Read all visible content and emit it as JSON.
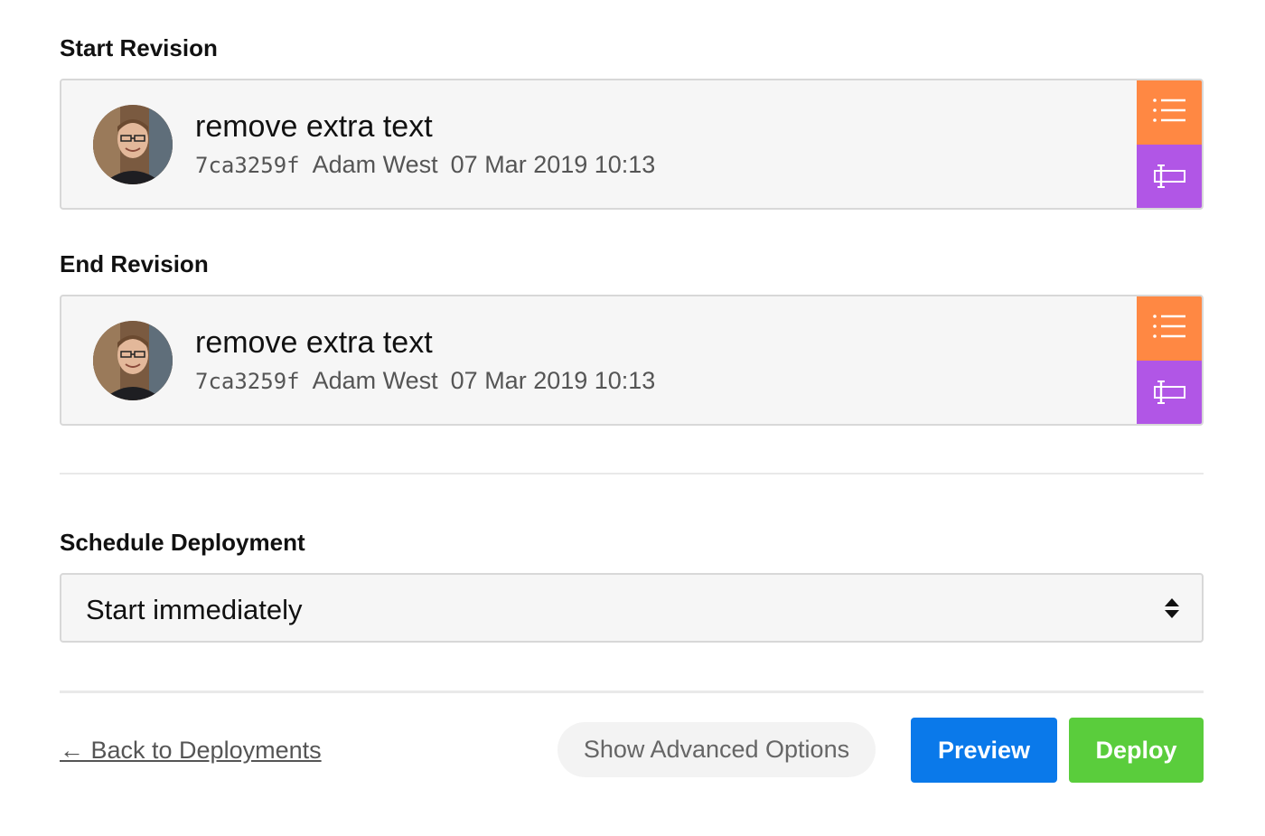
{
  "start_revision": {
    "label": "Start Revision",
    "message": "remove extra text",
    "hash": "7ca3259f",
    "author": "Adam West",
    "date": "07 Mar 2019 10:13",
    "list_icon": "list-icon",
    "branch_icon": "branch-select-icon"
  },
  "end_revision": {
    "label": "End Revision",
    "message": "remove extra text",
    "hash": "7ca3259f",
    "author": "Adam West",
    "date": "07 Mar 2019 10:13",
    "list_icon": "list-icon",
    "branch_icon": "branch-select-icon"
  },
  "schedule": {
    "label": "Schedule Deployment",
    "selected": "Start immediately"
  },
  "footer": {
    "back_link": "← Back to Deployments",
    "advanced_label": "Show Advanced Options",
    "preview_label": "Preview",
    "deploy_label": "Deploy"
  },
  "colors": {
    "list_button": "#ff8843",
    "branch_button": "#b156e6",
    "preview_button": "#0a79ea",
    "deploy_button": "#5acd3c"
  }
}
